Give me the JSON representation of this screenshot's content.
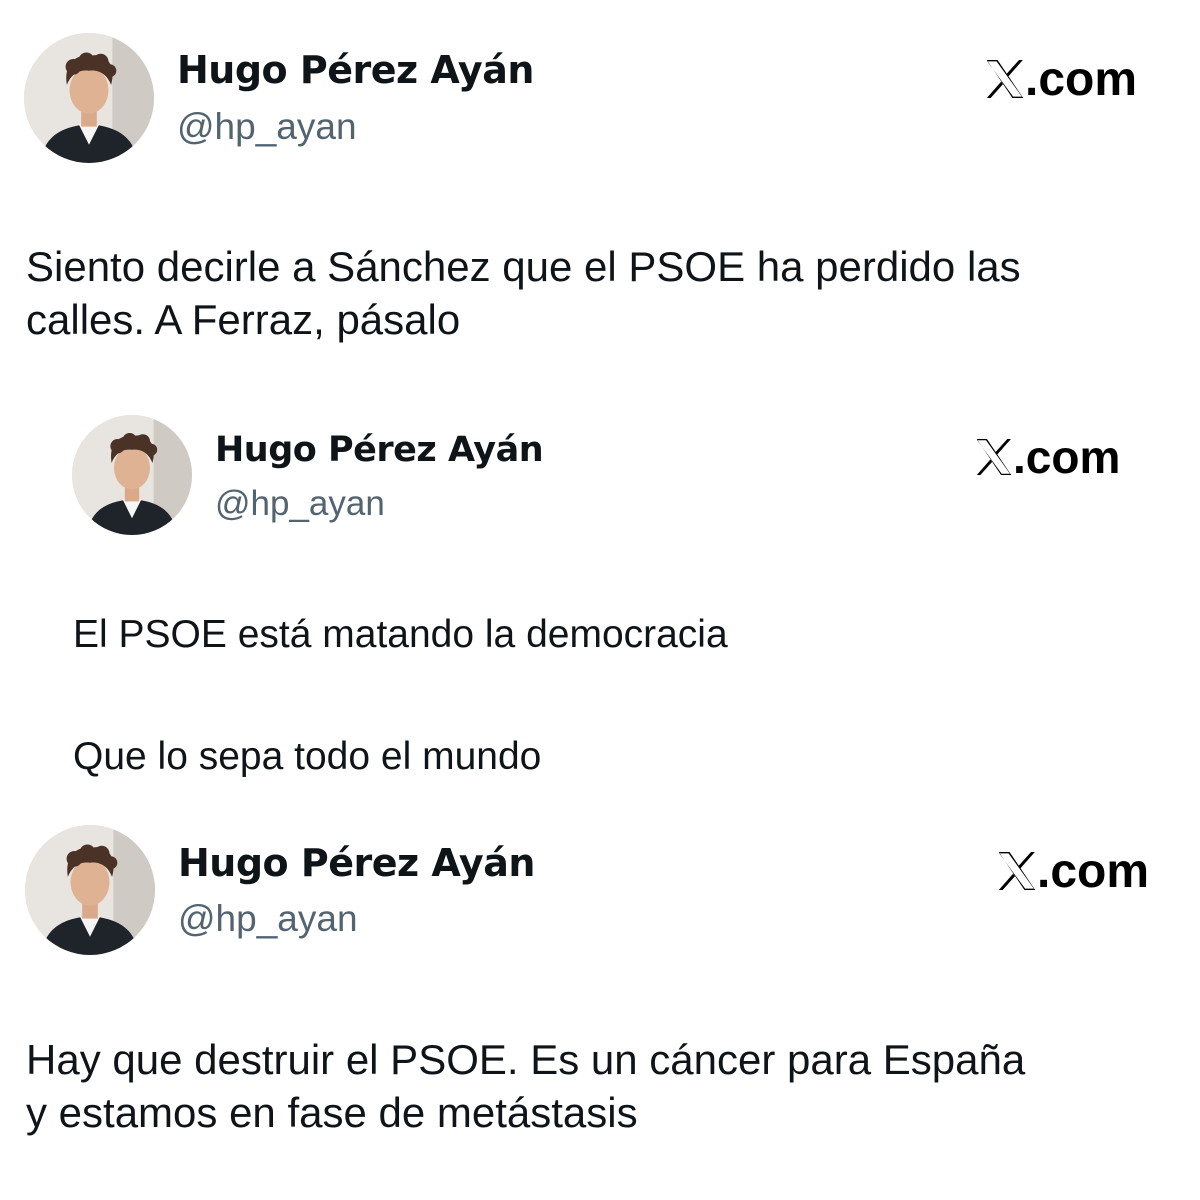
{
  "tweets": [
    {
      "author_name": "Hugo Pérez Ayán",
      "author_handle": "@hp_ayan",
      "source": ".com",
      "text_lines": [
        "Siento decirle a Sánchez que el PSOE ha perdido las",
        "calles. A Ferraz, pásalo"
      ]
    },
    {
      "author_name": "Hugo Pérez Ayán",
      "author_handle": "@hp_ayan",
      "source": ".com",
      "paragraphs": [
        "El PSOE está matando la democracia",
        "Que lo sepa todo el mundo"
      ]
    },
    {
      "author_name": "Hugo Pérez Ayán",
      "author_handle": "@hp_ayan",
      "source": ".com",
      "text_lines": [
        "Hay que destruir el PSOE. Es un cáncer para España",
        "y estamos en fase de metástasis"
      ]
    }
  ],
  "icons": {
    "avatar": "profile-photo",
    "logo": "x-logo"
  },
  "colors": {
    "text": "#0f1419",
    "handle": "#536471",
    "background": "#ffffff"
  }
}
